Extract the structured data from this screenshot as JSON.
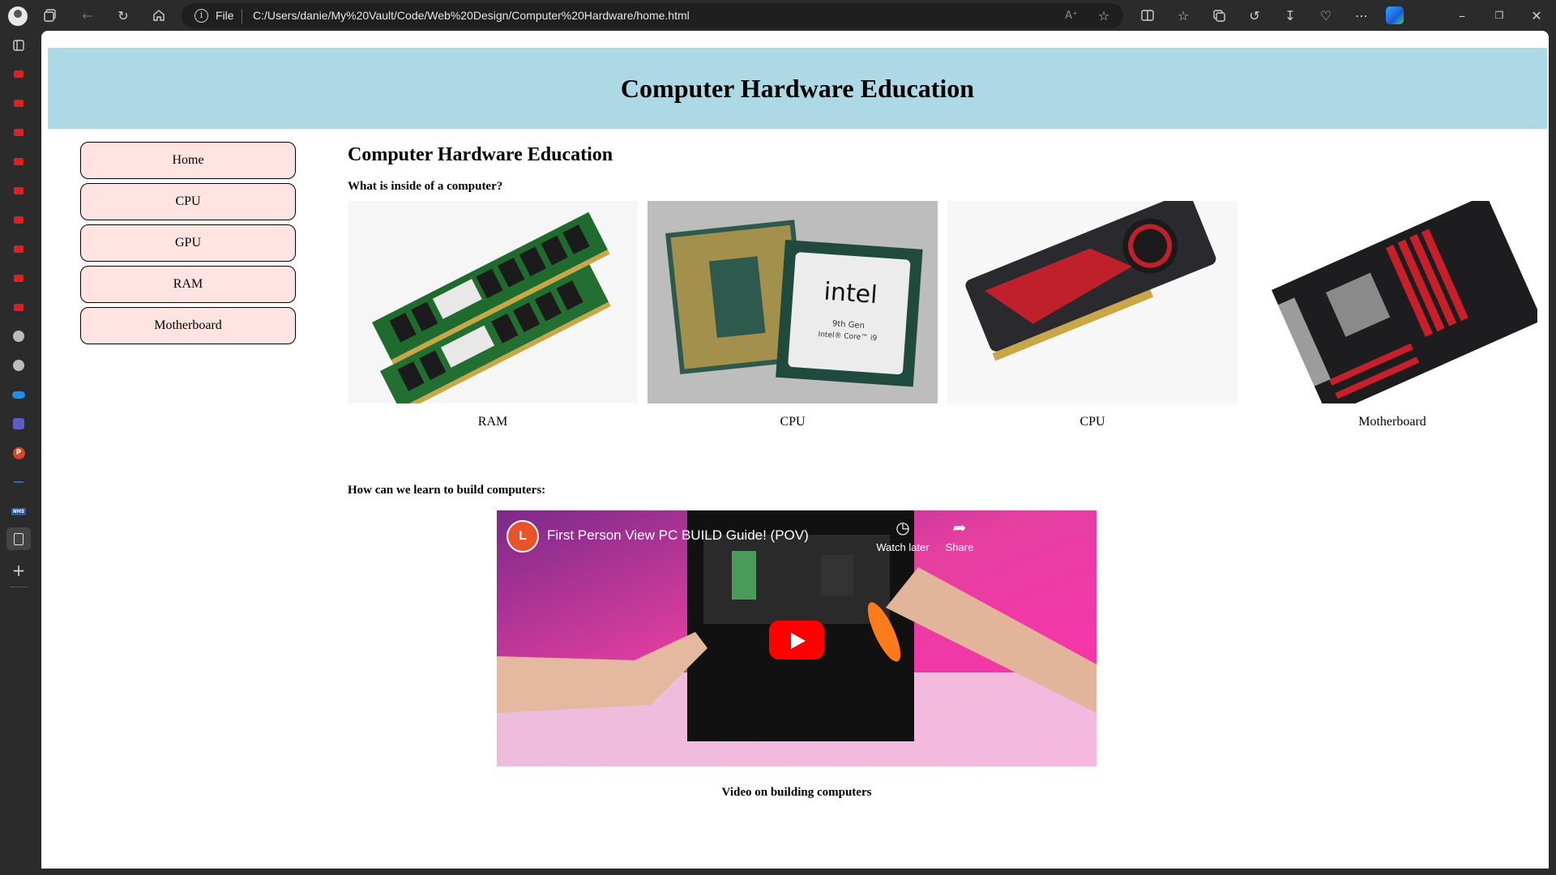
{
  "browser": {
    "address_protocol": "File",
    "address_url": "C:/Users/danie/My%20Vault/Code/Web%20Design/Computer%20Hardware/home.html"
  },
  "page": {
    "banner_title": "Computer Hardware Education",
    "heading": "Computer Hardware Education",
    "question_inside": "What is inside of a computer?",
    "question_learn": "How can we learn to build computers:",
    "video_caption": "Video on building computers"
  },
  "nav": {
    "items": [
      {
        "label": "Home"
      },
      {
        "label": "CPU"
      },
      {
        "label": "GPU"
      },
      {
        "label": "RAM"
      },
      {
        "label": "Motherboard"
      }
    ]
  },
  "gallery": {
    "items": [
      {
        "caption": "RAM",
        "icon": "ram-image"
      },
      {
        "caption": "CPU",
        "icon": "cpu-image"
      },
      {
        "caption": "CPU",
        "icon": "gpu-image"
      },
      {
        "caption": "Motherboard",
        "icon": "motherboard-image"
      }
    ]
  },
  "video": {
    "title": "First Person View PC BUILD Guide! (POV)",
    "watch_later": "Watch later",
    "share": "Share",
    "cpu_brand": "intel",
    "cpu_gen": "9th Gen",
    "cpu_model": "Intel® Core™ i9"
  },
  "colors": {
    "banner": "#add8e6",
    "nav_button": "#ffe4e1",
    "play_button": "#ff0000"
  }
}
